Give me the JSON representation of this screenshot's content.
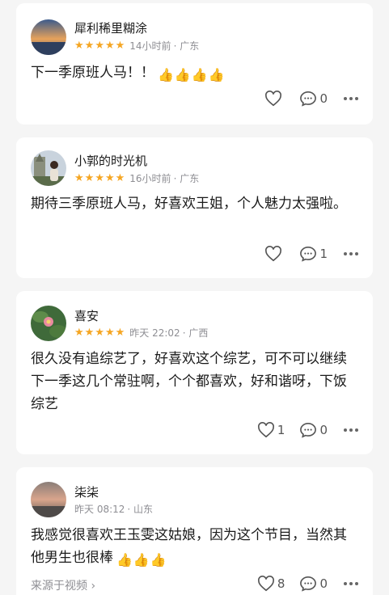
{
  "comments": [
    {
      "user": "犀利稀里糊涂",
      "rating": 5,
      "time": "14小时前",
      "location": "· 广东",
      "text": "下一季原班人马！！",
      "thumbs": 4,
      "likes": "",
      "replies": "0"
    },
    {
      "user": "小郭的时光机",
      "rating": 5,
      "time": "16小时前",
      "location": "· 广东",
      "text": "期待三季原班人马，好喜欢王姐，个人魅力太强啦。",
      "thumbs": 0,
      "likes": "",
      "replies": "1"
    },
    {
      "user": "喜安",
      "rating": 5,
      "time": "昨天 22:02",
      "location": "· 广西",
      "text": "很久没有追综艺了，好喜欢这个综艺，可不可以继续下一季这几个常驻啊，个个都喜欢，好和谐呀，下饭综艺",
      "thumbs": 0,
      "likes": "1",
      "replies": "0"
    },
    {
      "user": "柒柒",
      "rating": 0,
      "time": "昨天 08:12",
      "location": "· 山东",
      "text": "我感觉很喜欢王玉雯这姑娘，因为这个节目，当然其他男生也很棒",
      "thumbs": 3,
      "likes": "8",
      "replies": "0",
      "source": "来源于视频 ›"
    }
  ],
  "colors": {
    "star": "#f5a623",
    "thumb": "#f0a020",
    "meta": "#8e8e93",
    "card_bg": "#ffffff",
    "page_bg": "#f5f5f5"
  },
  "icons": [
    "star-icon",
    "heart-icon",
    "comment-icon",
    "more-icon",
    "thumbs-up-icon"
  ]
}
